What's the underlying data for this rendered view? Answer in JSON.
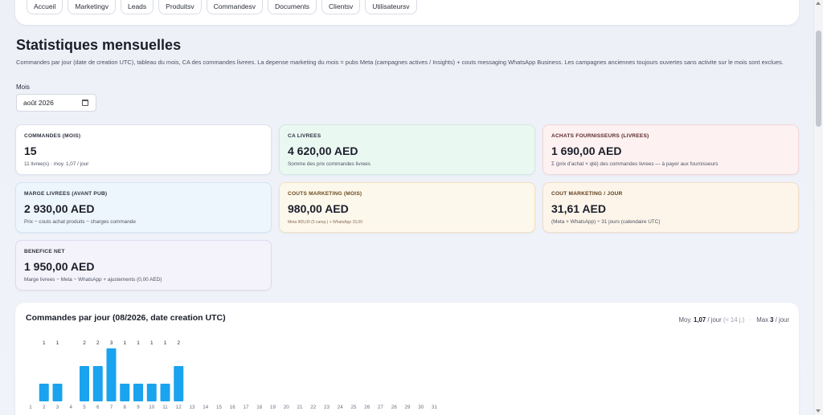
{
  "nav": {
    "items": [
      "Accueil",
      "Marketingv",
      "Leads",
      "Produitsv",
      "Commandesv",
      "Documents",
      "Clientsv",
      "Utilisateursv"
    ]
  },
  "page": {
    "title": "Statistiques mensuelles",
    "description": "Commandes par jour (date de creation UTC), tableau du mois, CA des commandes livrees. La depense marketing du mois = pubs Meta (campagnes actives / Insights) + couts messaging WhatsApp Business. Les campagnes anciennes toujours ouvertes sans activite sur le mois sont exclues.",
    "month_label": "Mois",
    "month_value": "août 2026"
  },
  "cards": {
    "commandes": {
      "label": "COMMANDES (MOIS)",
      "value": "15",
      "sub": "11 livree(s) · moy. 1,07 / jour"
    },
    "ca": {
      "label": "CA LIVREES",
      "value": "4 620,00 AED",
      "sub": "Somme des prix commandes livrees"
    },
    "achats": {
      "label": "ACHATS FOURNISSEURS (LIVREES)",
      "value": "1 690,00 AED",
      "sub": "Σ (prix d'achat × qté) des commandes livrees — à payer aux fournisseurs"
    },
    "marge": {
      "label": "MARGE LIVREES (AVANT PUB)",
      "value": "2 930,00 AED",
      "sub": "Prix − couts achat produits − charges commande"
    },
    "marketing": {
      "label": "COUTS MARKETING (MOIS)",
      "value": "980,00 AED",
      "sub": "Meta 965,00 (5 camp.) + WhatsApp 15,00"
    },
    "cout_jour": {
      "label": "COUT MARKETING / JOUR",
      "value": "31,61 AED",
      "sub": "(Meta + WhatsApp) ÷ 31 jours (calendaire UTC)"
    },
    "benefice": {
      "label": "BENEFICE NET",
      "value": "1 950,00 AED",
      "sub": "Marge livrees − Meta − WhatsApp + ajustements (0,00 AED)"
    }
  },
  "chart_header": {
    "title": "Commandes par jour (08/2026, date creation UTC)",
    "moy_prefix": "Moy.",
    "moy_value": "1,07",
    "moy_suffix": "/ jour",
    "moy_note": "(≈ 14 j.)",
    "max_prefix": "Max",
    "max_value": "3",
    "max_suffix": "/ jour"
  },
  "chart_data": {
    "type": "bar",
    "title": "Commandes par jour (08/2026, date creation UTC)",
    "categories": [
      "1",
      "2",
      "3",
      "4",
      "5",
      "6",
      "7",
      "8",
      "9",
      "10",
      "11",
      "12",
      "13",
      "14",
      "15",
      "16",
      "17",
      "18",
      "19",
      "20",
      "21",
      "22",
      "23",
      "24",
      "25",
      "26",
      "27",
      "28",
      "29",
      "30",
      "31"
    ],
    "values": [
      0,
      1,
      1,
      0,
      2,
      2,
      3,
      1,
      1,
      1,
      1,
      2,
      0,
      0,
      0,
      0,
      0,
      0,
      0,
      0,
      0,
      0,
      0,
      0,
      0,
      0,
      0,
      0,
      0,
      0,
      0
    ],
    "ylim": [
      0,
      3
    ],
    "color": "#1aa3ee",
    "grid": false,
    "data_labels": true
  }
}
